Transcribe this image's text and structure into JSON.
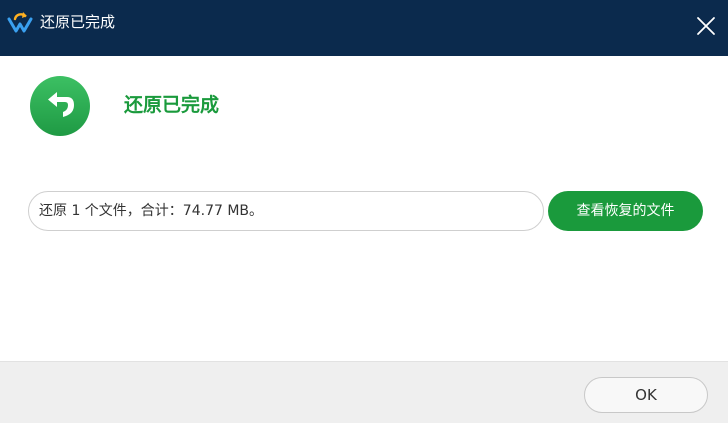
{
  "window": {
    "title": "还原已完成",
    "logo_icon": "app-logo-icon",
    "close_icon": "close-icon"
  },
  "main": {
    "status_icon": "undo-arrow-icon",
    "heading": "还原已完成",
    "summary": "还原 1 个文件，合计：74.77 MB。",
    "view_button_label": "查看恢复的文件"
  },
  "footer": {
    "ok_label": "OK"
  },
  "colors": {
    "titlebar": "#0b2a4d",
    "accent_green": "#1a9a3c",
    "footer_bg": "#efefef"
  }
}
